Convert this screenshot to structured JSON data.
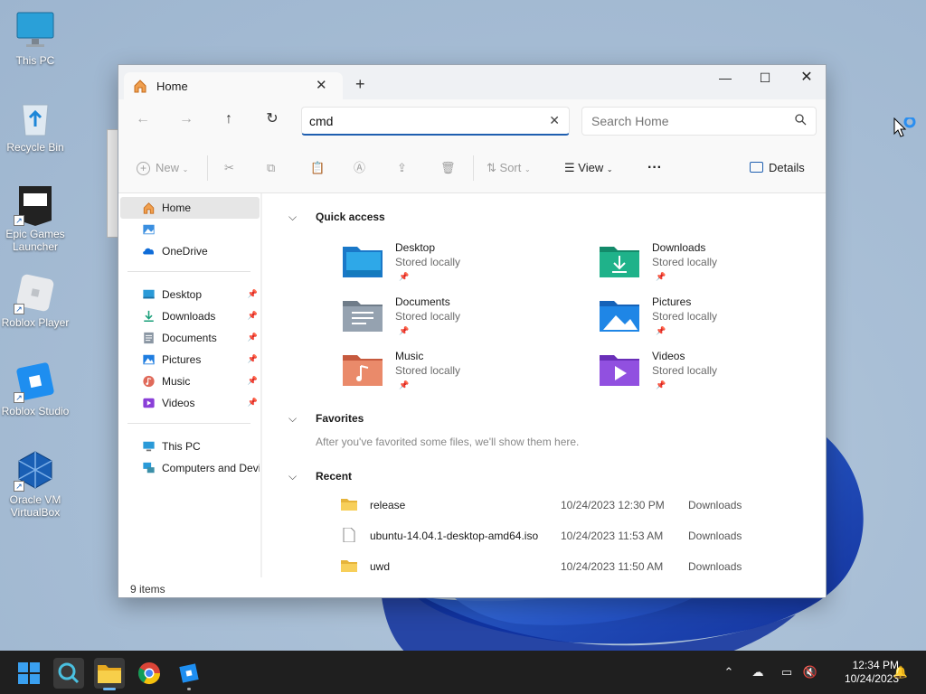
{
  "desktop": {
    "icons": [
      {
        "label": "This PC"
      },
      {
        "label": "Recycle Bin"
      },
      {
        "label": "Epic Games Launcher"
      },
      {
        "label": "Roblox Player"
      },
      {
        "label": "Roblox Studio"
      },
      {
        "label": "Oracle VM VirtualBox"
      }
    ]
  },
  "explorer": {
    "tab_title": "Home",
    "address_value": "cmd",
    "search_placeholder": "Search Home",
    "toolbar": {
      "new_label": "New",
      "sort_label": "Sort",
      "view_label": "View",
      "more_label": "···",
      "details_label": "Details"
    },
    "nav": {
      "home": "Home",
      "onedrive": "OneDrive",
      "pinned": [
        {
          "label": "Desktop"
        },
        {
          "label": "Downloads"
        },
        {
          "label": "Documents"
        },
        {
          "label": "Pictures"
        },
        {
          "label": "Music"
        },
        {
          "label": "Videos"
        }
      ],
      "this_pc": "This PC",
      "network": "Computers and Devices"
    },
    "quick_access": {
      "heading": "Quick access",
      "items": [
        {
          "name": "Desktop",
          "sub": "Stored locally"
        },
        {
          "name": "Downloads",
          "sub": "Stored locally"
        },
        {
          "name": "Documents",
          "sub": "Stored locally"
        },
        {
          "name": "Pictures",
          "sub": "Stored locally"
        },
        {
          "name": "Music",
          "sub": "Stored locally"
        },
        {
          "name": "Videos",
          "sub": "Stored locally"
        }
      ]
    },
    "favorites": {
      "heading": "Favorites",
      "empty_text": "After you've favorited some files, we'll show them here."
    },
    "recent": {
      "heading": "Recent",
      "rows": [
        {
          "name": "release",
          "date": "10/24/2023 12:30 PM",
          "location": "Downloads"
        },
        {
          "name": "ubuntu-14.04.1-desktop-amd64.iso",
          "date": "10/24/2023 11:53 AM",
          "location": "Downloads"
        },
        {
          "name": "uwd",
          "date": "10/24/2023 11:50 AM",
          "location": "Downloads"
        }
      ]
    },
    "status": "9 items"
  },
  "taskbar": {
    "time": "12:34 PM",
    "date": "10/24/2023"
  },
  "colors": {
    "accent": "#1f5fb0",
    "taskbar": "#1f1f1f"
  }
}
